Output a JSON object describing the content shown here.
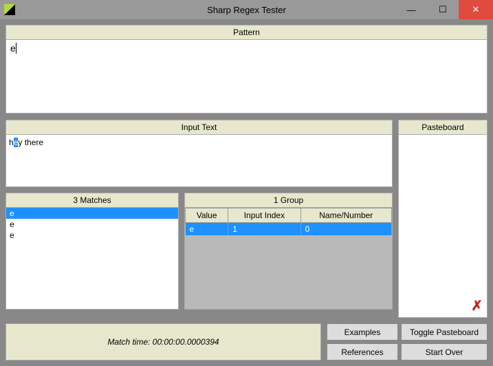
{
  "window": {
    "title": "Sharp Regex Tester"
  },
  "pattern": {
    "header": "Pattern",
    "value": "e"
  },
  "inputText": {
    "header": "Input Text",
    "prefix": "h",
    "highlight": "e",
    "suffix": "y there"
  },
  "pasteboard": {
    "header": "Pasteboard"
  },
  "matches": {
    "header": "3 Matches",
    "items": [
      "e",
      "e",
      "e"
    ],
    "selectedIndex": 0
  },
  "groups": {
    "header": "1 Group",
    "columns": [
      "Value",
      "Input Index",
      "Name/Number"
    ],
    "rows": [
      {
        "value": "e",
        "index": "1",
        "name": "0"
      }
    ]
  },
  "status": {
    "text": "Match time: 00:00:00.0000394"
  },
  "buttons": {
    "examples": "Examples",
    "togglePasteboard": "Toggle Pasteboard",
    "references": "References",
    "startOver": "Start Over"
  }
}
